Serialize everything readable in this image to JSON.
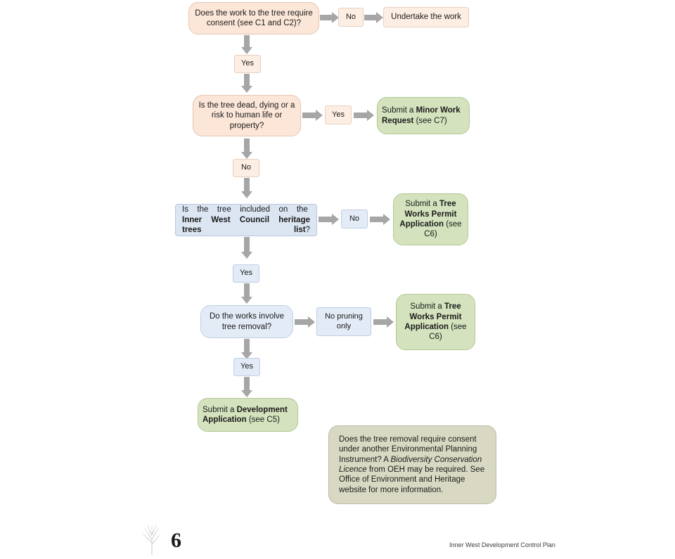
{
  "diagram": {
    "nodes": [
      {
        "id": "q1",
        "text": "Does the work to the tree require consent (see C1 and C2)?",
        "html": "Does the work to the tree require consent (see C1 and C2)?"
      },
      {
        "id": "q1-no",
        "text": "No"
      },
      {
        "id": "undertake",
        "text": "Undertake the work"
      },
      {
        "id": "q1-yes",
        "text": "Yes"
      },
      {
        "id": "q2",
        "text": "Is the tree dead, dying or a risk to human life or property?"
      },
      {
        "id": "q2-yes",
        "text": "Yes"
      },
      {
        "id": "minor-work",
        "html": "Submit a <b>Minor Work Request</b> (see C7)"
      },
      {
        "id": "q2-no",
        "text": "No"
      },
      {
        "id": "q3",
        "html": "Is&nbsp; the&nbsp; tree&nbsp; included&nbsp; on&nbsp; the&nbsp; <b>Inner West Council heritage trees list</b>?"
      },
      {
        "id": "q3-no",
        "text": "No"
      },
      {
        "id": "tree-permit-1",
        "html": "Submit a <b>Tree Works Permit Application</b> (see C6)"
      },
      {
        "id": "q3-yes",
        "text": "Yes"
      },
      {
        "id": "q4",
        "text": "Do the works involve tree removal?"
      },
      {
        "id": "q4-no",
        "text": "No pruning only"
      },
      {
        "id": "tree-permit-2",
        "html": "Submit a <b>Tree Works Permit Application</b> (see C6)"
      },
      {
        "id": "q4-yes",
        "text": "Yes"
      },
      {
        "id": "development-app",
        "html": "Submit a <b>Development Application</b> (see C5)"
      },
      {
        "id": "note",
        "html": "Does the tree removal require consent under another Environmental Planning Instrument? A <i>Biodiversity Conservation Licence</i> from OEH may be required. See Office of Environment and Heritage website for more information."
      }
    ]
  },
  "footer": {
    "page_number": "6",
    "document_title": "Inner West Development Control Plan"
  },
  "colors": {
    "peach": "#fbe6d8",
    "blue": "#dce6f2",
    "green": "#d4e2bd",
    "khaki": "#d9d9c3",
    "arrow": "#a6a6a6"
  }
}
